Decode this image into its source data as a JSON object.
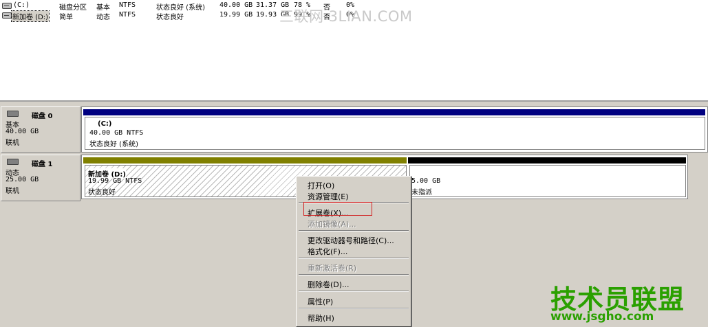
{
  "volumes": [
    {
      "name": "(C:)",
      "layout": "磁盘分区",
      "type": "基本",
      "fs": "NTFS",
      "status": "状态良好 (系统)",
      "capacity": "40.00 GB",
      "free": "31.37 GB",
      "pct": "78 %",
      "fault": "否",
      "overhead": "0%"
    },
    {
      "name": "新加卷 (D:)",
      "layout": "简单",
      "type": "动态",
      "fs": "NTFS",
      "status": "状态良好",
      "capacity": "19.99 GB",
      "free": "19.93 GB",
      "pct": "99 %",
      "fault": "否",
      "overhead": "0%"
    }
  ],
  "watermark_top": "三联网 3LIAN.COM",
  "disks": [
    {
      "title": "磁盘 0",
      "type": "基本",
      "size": "40.00 GB",
      "state": "联机",
      "partitions": [
        {
          "name": "(C:)",
          "size_fs": "40.00 GB NTFS",
          "status": "状态良好 (系统)",
          "bar_color": "#000080"
        }
      ]
    },
    {
      "title": "磁盘 1",
      "type": "动态",
      "size": "25.00 GB",
      "state": "联机",
      "partitions": [
        {
          "name": "新加卷  (D:)",
          "size_fs": "19.99 GB NTFS",
          "status": "状态良好",
          "bar_color": "#808000"
        },
        {
          "name": "",
          "size_fs": "5.00 GB",
          "status": "未指派",
          "bar_color": "#000000"
        }
      ]
    }
  ],
  "menu": {
    "open": "打开(O)",
    "explore": "资源管理(E)",
    "extend": "扩展卷(X)...",
    "add_mirror": "添加镜像(A)...",
    "change_letter": "更改驱动器号和路径(C)...",
    "format": "格式化(F)...",
    "reactivate": "重新激活卷(R)",
    "delete": "删除卷(D)...",
    "properties": "属性(P)",
    "help": "帮助(H)"
  },
  "branding": {
    "logo": "技术员联盟",
    "url": "www.jsgho.com"
  }
}
